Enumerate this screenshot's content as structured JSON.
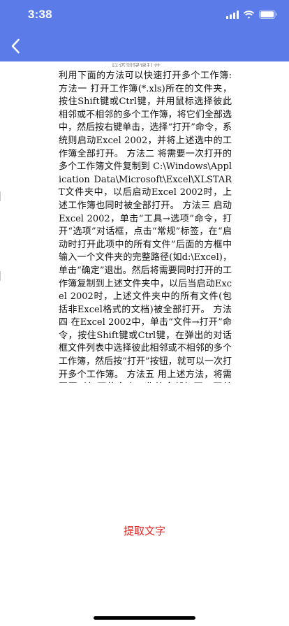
{
  "theme": {
    "accent": "#5b7ce8",
    "button_text_color": "#e52222"
  },
  "status_bar": {
    "time": "3:38",
    "icons": [
      "signal-icon",
      "wifi-icon",
      "battery-icon"
    ]
  },
  "nav": {
    "back_icon": "chevron-left-icon"
  },
  "document": {
    "top_clip": "…以达到快速打开…",
    "body": "利用下面的方法可以快速打开多个工作簿: 方法一 打开工作簿(*.xls)所在的文件夹，按住Shift键或Ctrl键，并用鼠标选择彼此相邻或不相邻的多个工作簿，将它们全部选中，然后按右键单击，选择“打开”命令，系统则启动Excel 2002，并将上述选中的工作簿全部打开。 方法二 将需要一次打开的多个工作簿文件复制到 C:\\Windows\\Application Data\\Microsoft\\Excel\\XLSTART文件夹中，以后启动Excel 2002时，上述工作簿也同时被全部打开。 方法三 启动Excel 2002，单击“工具→选项”命令，打开“选项”对话框，点击“常规”标签，在“启动时打开此项中的所有文件”后面的方框中输入一个文件夹的完整路径(如d:\\Excel)，单击“确定”退出。然后将需要同时打开的工作簿复制到上述文件夹中，以后当启动Excel 2002时，上述文件夹中的所有文件(包括非Excel格式的文档)被全部打开。 方法四 在Excel 2002中，单击“文件→打开”命令，按住Shift键或Ctrl键，在弹出的对话框文件列表中选择彼此相邻或不相邻的多个工作簿，然后按“打开”按钮，就可以一次打开多个工作簿。 方法五 用上述方法，将需要同时打开的多个工作簿全部打开，再单击“文件→保存工作区”命令，打开“保存工作区”对话框，取名保存。以后只要用Excel 2002打开该工作区"
  },
  "actions": {
    "extract_text_label": "提取文字"
  }
}
